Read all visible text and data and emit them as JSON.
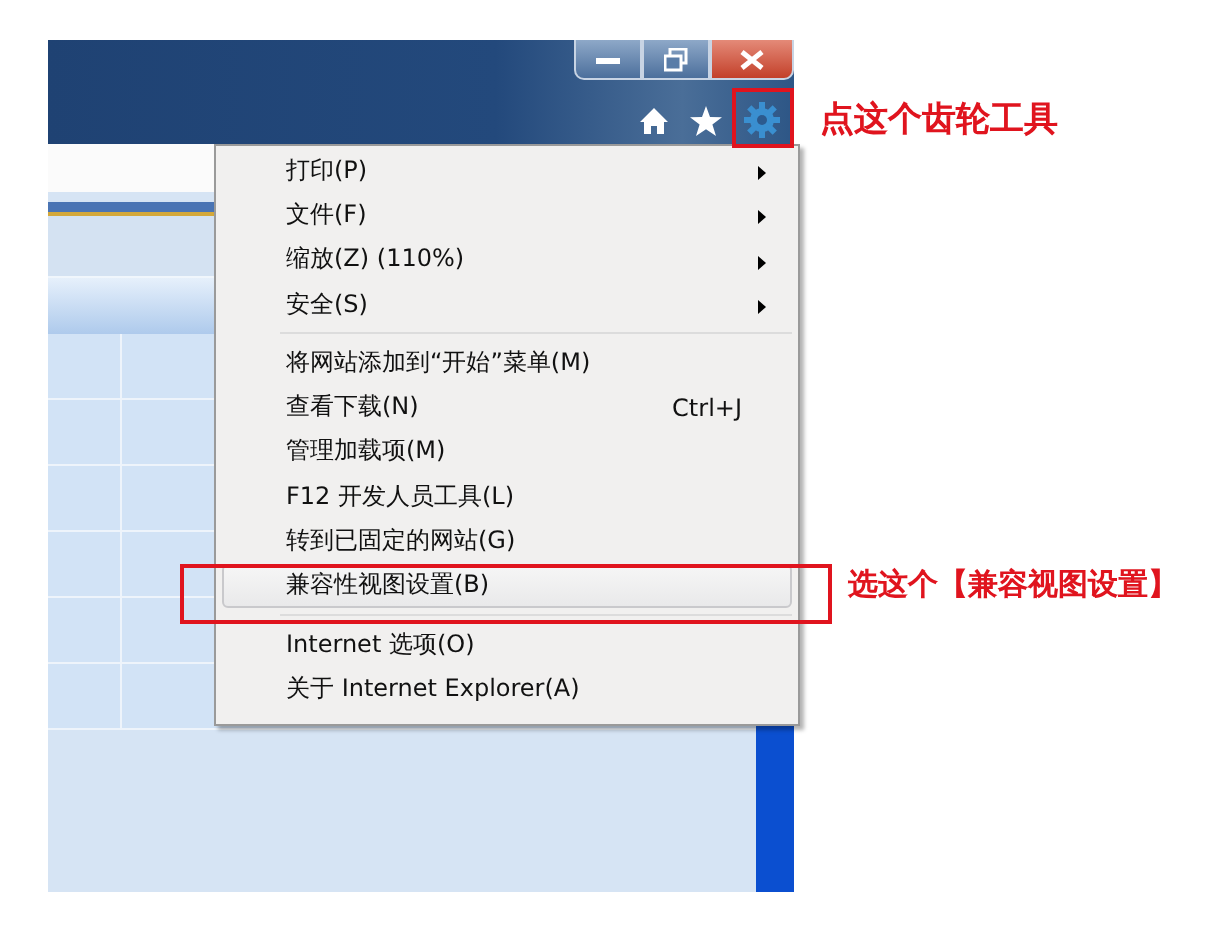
{
  "menu": {
    "items": [
      {
        "label": "打印(P)",
        "submenu": true,
        "selected": false,
        "separator_after": false
      },
      {
        "label": "文件(F)",
        "submenu": true,
        "selected": false,
        "separator_after": false
      },
      {
        "label": "缩放(Z) (110%)",
        "submenu": true,
        "selected": false,
        "separator_after": false
      },
      {
        "label": "安全(S)",
        "submenu": true,
        "selected": false,
        "separator_after": true
      },
      {
        "label": "将网站添加到“开始”菜单(M)",
        "submenu": false,
        "selected": false,
        "separator_after": false
      },
      {
        "label": "查看下载(N)",
        "shortcut": "Ctrl+J",
        "submenu": false,
        "selected": false,
        "separator_after": false
      },
      {
        "label": "管理加载项(M)",
        "submenu": false,
        "selected": false,
        "separator_after": false
      },
      {
        "label": "F12 开发人员工具(L)",
        "submenu": false,
        "selected": false,
        "separator_after": false
      },
      {
        "label": "转到已固定的网站(G)",
        "submenu": false,
        "selected": false,
        "separator_after": false
      },
      {
        "label": "兼容性视图设置(B)",
        "submenu": false,
        "selected": true,
        "separator_after": true
      },
      {
        "label": "Internet 选项(O)",
        "submenu": false,
        "selected": false,
        "separator_after": false
      },
      {
        "label": "关于 Internet Explorer(A)",
        "submenu": false,
        "selected": false,
        "separator_after": false
      }
    ]
  },
  "annotations": [
    {
      "kind": "gear",
      "text": "点这个齿轮工具"
    },
    {
      "kind": "menu_item",
      "text": "选这个【兼容视图设置】"
    }
  ]
}
